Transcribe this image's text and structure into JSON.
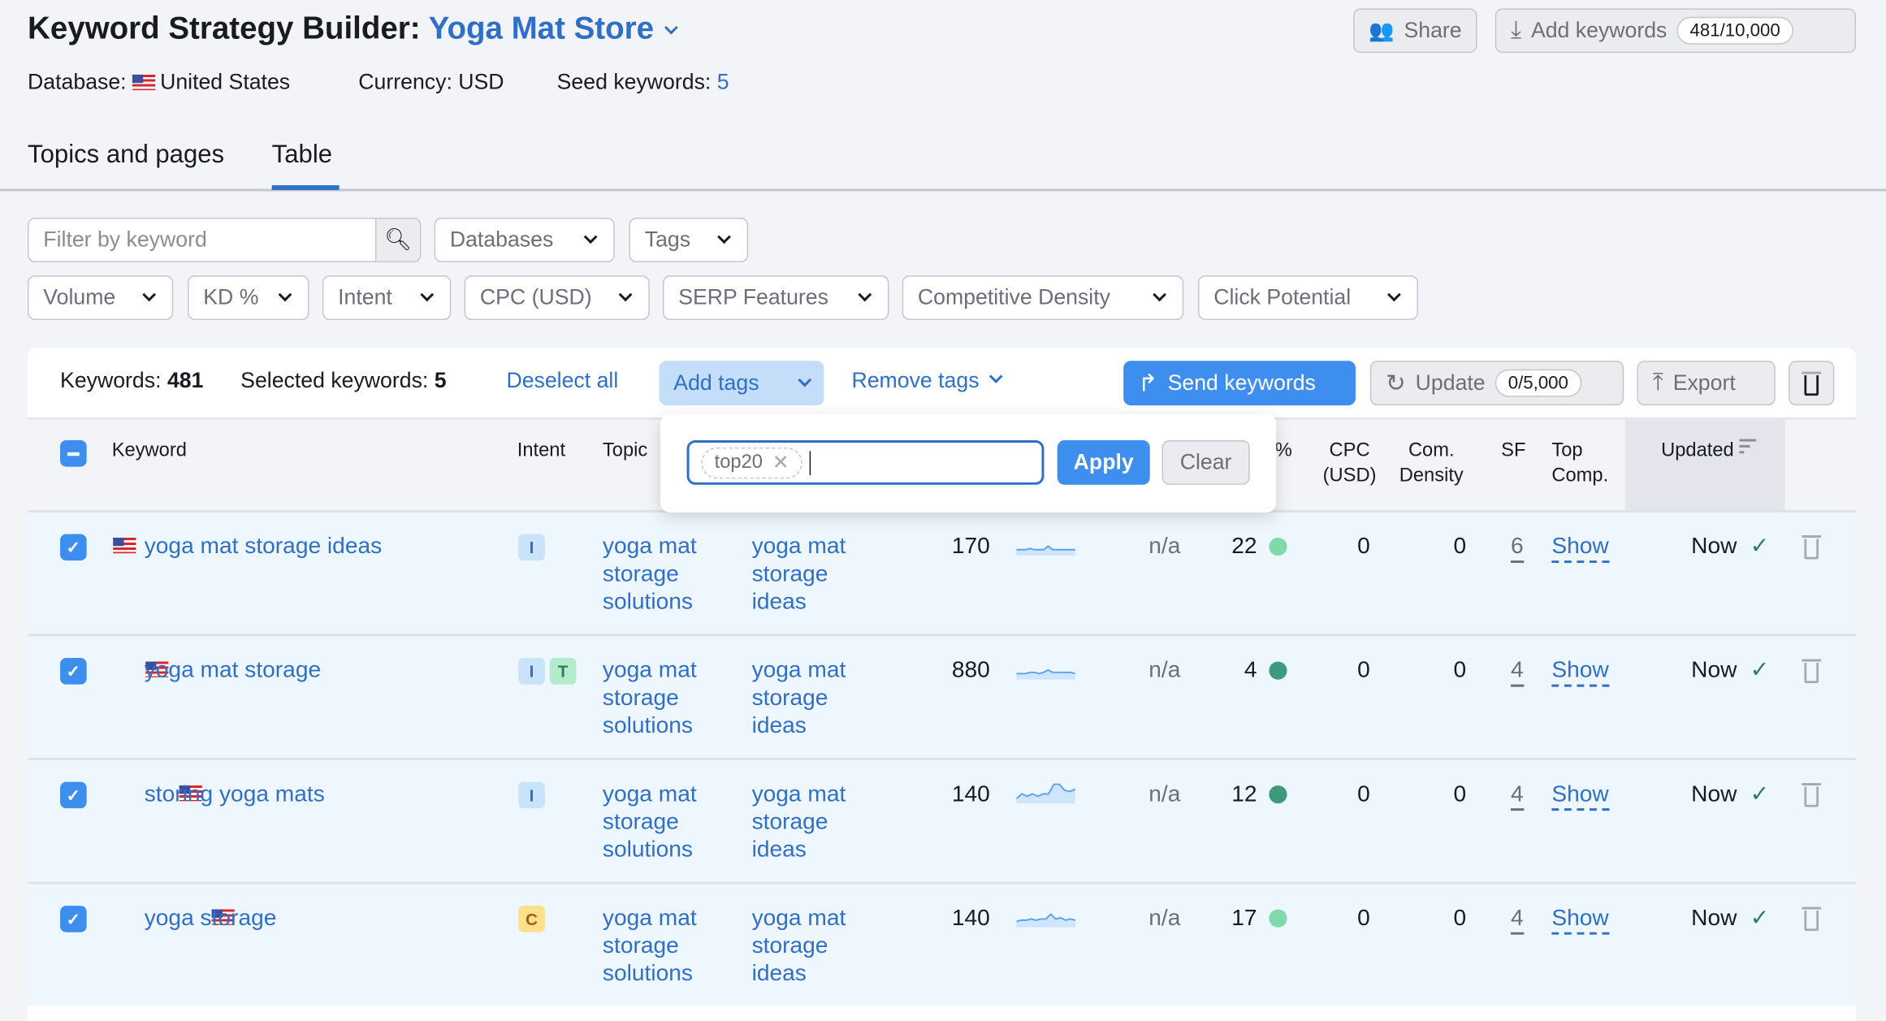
{
  "header": {
    "title_prefix": "Keyword Strategy Builder:",
    "project": "Yoga Mat Store",
    "share": "Share",
    "add_keywords": "Add keywords",
    "add_keywords_count": "481/10,000"
  },
  "meta": {
    "database_label": "Database:",
    "database": "United States",
    "currency": "Currency: USD",
    "seed_label": "Seed keywords:",
    "seed_count": "5"
  },
  "tabs": [
    {
      "label": "Topics and pages",
      "active": false
    },
    {
      "label": "Table",
      "active": true
    }
  ],
  "filters": {
    "search_placeholder": "Filter by keyword",
    "row1": [
      "Databases",
      "Tags"
    ],
    "row2": [
      "Volume",
      "KD %",
      "Intent",
      "CPC (USD)",
      "SERP Features",
      "Competitive Density",
      "Click Potential"
    ]
  },
  "toolbar": {
    "keywords_label": "Keywords:",
    "keywords_count": "481",
    "selected_label": "Selected keywords:",
    "selected_count": "5",
    "deselect": "Deselect all",
    "add_tags": "Add tags",
    "remove_tags": "Remove tags",
    "send": "Send keywords",
    "update": "Update",
    "update_count": "0/5,000",
    "export": "Export"
  },
  "popup": {
    "tag": "top20",
    "apply": "Apply",
    "clear": "Clear"
  },
  "columns": {
    "keyword": "Keyword",
    "intent": "Intent",
    "topic": "Topic",
    "kd_fragment": "%",
    "cpc": "CPC",
    "cpc2": "(USD)",
    "com": "Com.",
    "com2": "Density",
    "sf": "SF",
    "top": "Top",
    "top2": "Comp.",
    "updated": "Updated"
  },
  "colors": {
    "accent": "#3e8ef0",
    "link": "#2f6fc8",
    "kd_light": "#7fd9a9",
    "kd_dark": "#3e9a7d",
    "intent_I": "#c9e3fb",
    "intent_T": "#b4ebcc",
    "intent_C": "#fbe08d"
  },
  "rows": [
    {
      "keyword": "yoga mat storage ideas",
      "intents": [
        "I"
      ],
      "topic": [
        "yoga mat",
        "storage",
        "solutions"
      ],
      "page": [
        "yoga mat",
        "storage",
        "ideas"
      ],
      "volume": "170",
      "trend": [
        3,
        3,
        3,
        4,
        3,
        3,
        3,
        6,
        3,
        3,
        3,
        3,
        3,
        3
      ],
      "cpc_na": "n/a",
      "kd": "22",
      "kd_color": "#7fd9a9",
      "cpc": "0",
      "com": "0",
      "sf": "6",
      "show": "Show",
      "updated": "Now"
    },
    {
      "keyword": "yoga mat storage",
      "intents": [
        "I",
        "T"
      ],
      "topic": [
        "yoga mat",
        "storage",
        "solutions"
      ],
      "page": [
        "yoga mat",
        "storage",
        "ideas"
      ],
      "volume": "880",
      "trend": [
        3,
        3,
        3,
        4,
        4,
        3,
        4,
        6,
        4,
        4,
        4,
        4,
        4,
        3
      ],
      "cpc_na": "n/a",
      "kd": "4",
      "kd_color": "#3e9a7d",
      "cpc": "0",
      "com": "0",
      "sf": "4",
      "show": "Show",
      "updated": "Now"
    },
    {
      "keyword": "storing yoga mats",
      "intents": [
        "I"
      ],
      "topic": [
        "yoga mat",
        "storage",
        "solutions"
      ],
      "page": [
        "yoga mat",
        "storage",
        "ideas"
      ],
      "volume": "140",
      "trend": [
        2,
        6,
        4,
        6,
        4,
        6,
        6,
        14,
        14,
        9,
        8,
        10
      ],
      "cpc_na": "n/a",
      "kd": "12",
      "kd_color": "#3e9a7d",
      "cpc": "0",
      "com": "0",
      "sf": "4",
      "show": "Show",
      "updated": "Now"
    },
    {
      "keyword": "yoga storage",
      "intents": [
        "C"
      ],
      "topic": [
        "yoga mat",
        "storage",
        "solutions"
      ],
      "page": [
        "yoga mat",
        "storage",
        "ideas"
      ],
      "volume": "140",
      "trend": [
        3,
        4,
        4,
        5,
        4,
        5,
        5,
        9,
        5,
        6,
        4,
        5,
        4
      ],
      "cpc_na": "n/a",
      "kd": "17",
      "kd_color": "#7fd9a9",
      "cpc": "0",
      "com": "0",
      "sf": "4",
      "show": "Show",
      "updated": "Now"
    }
  ]
}
